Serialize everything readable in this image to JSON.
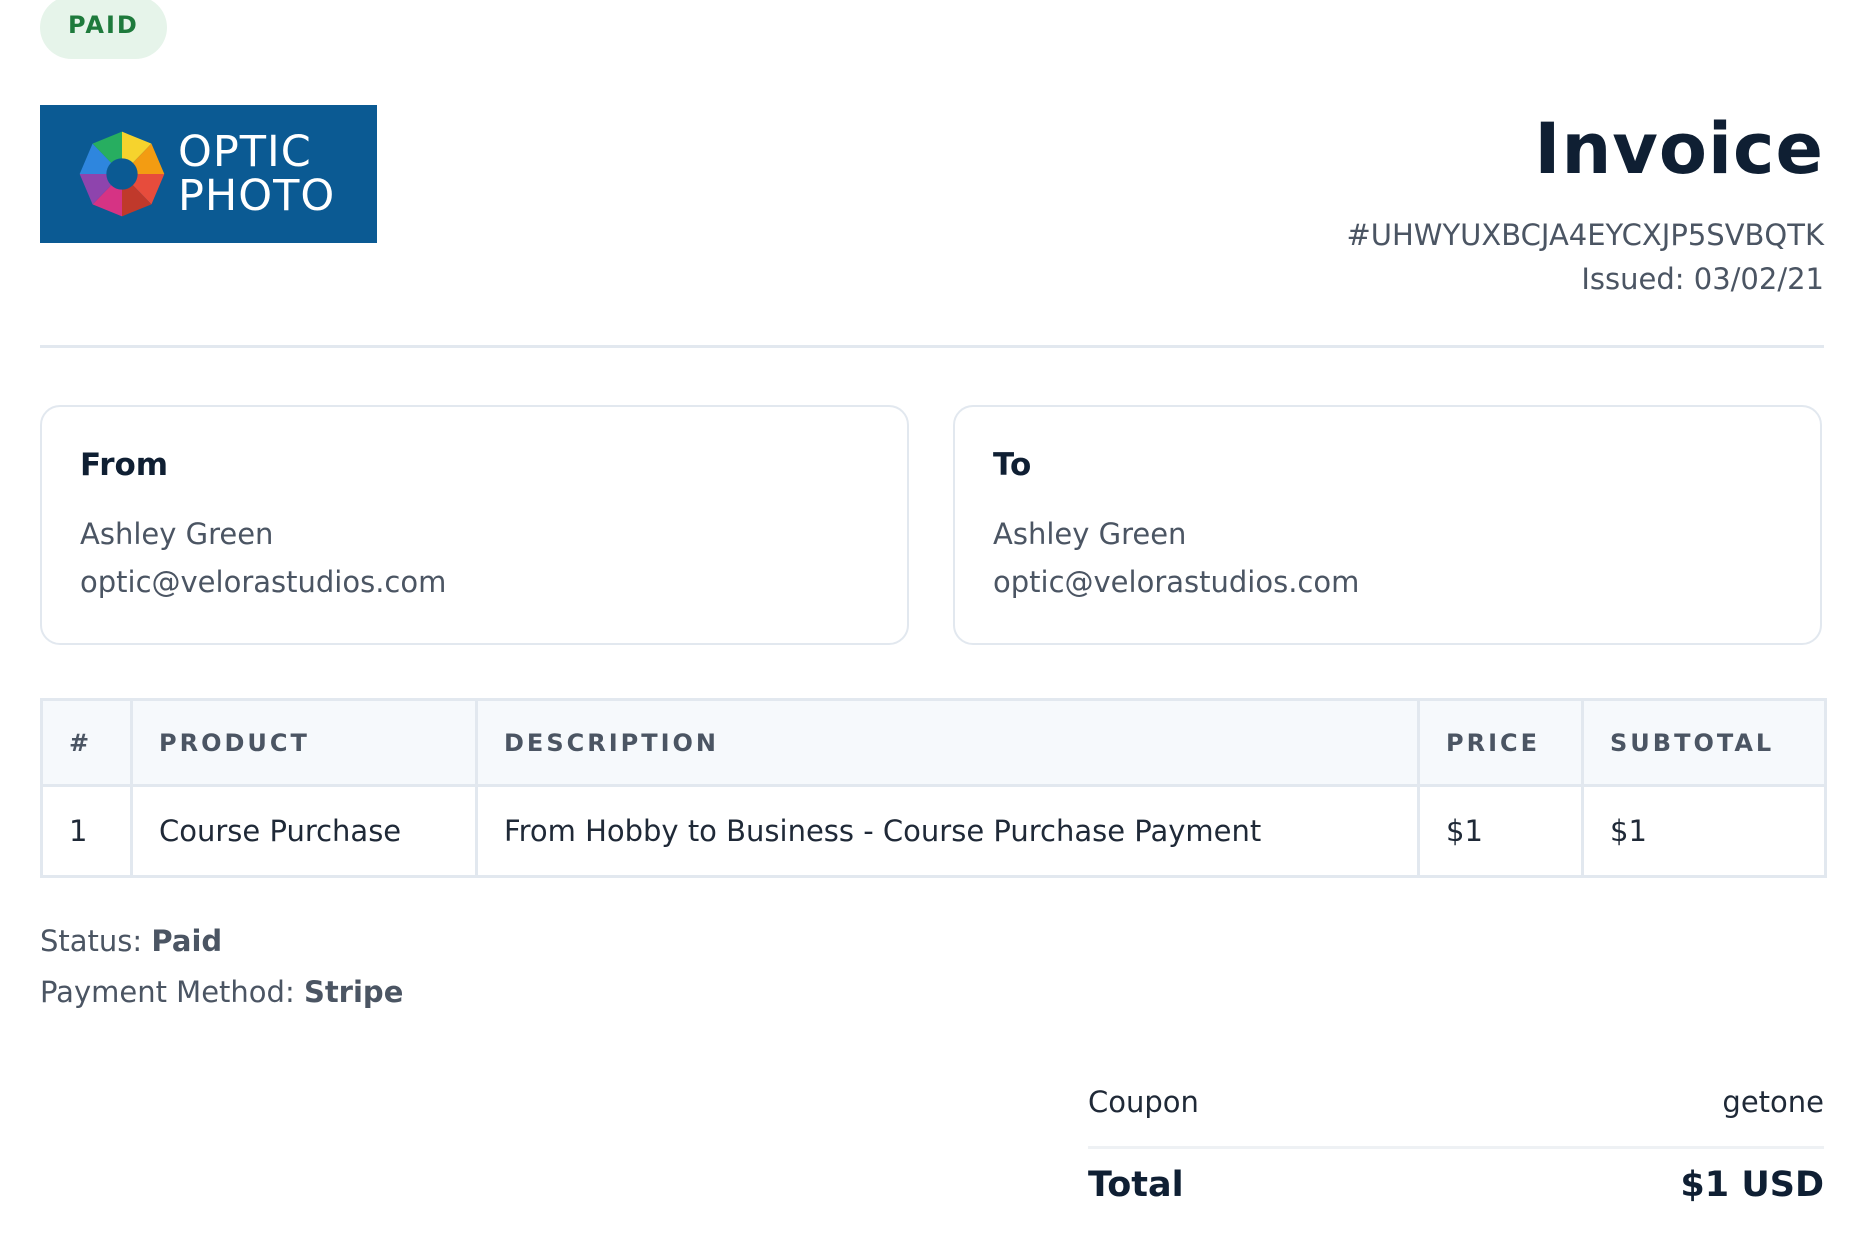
{
  "badge": {
    "label": "PAID",
    "color": "#1e7a3c",
    "background": "#e6f4ea"
  },
  "logo": {
    "line1": "OPTIC",
    "line2": "PHOTO",
    "background": "#0b5a93"
  },
  "header": {
    "title": "Invoice",
    "invoice_number": "#UHWYUXBCJA4EYCXJP5SVBQTK",
    "issued_label": "Issued:",
    "issued_date": "03/02/21"
  },
  "from": {
    "heading": "From",
    "name": "Ashley Green",
    "email": "optic@velorastudios.com"
  },
  "to": {
    "heading": "To",
    "name": "Ashley Green",
    "email": "optic@velorastudios.com"
  },
  "table": {
    "headers": [
      "#",
      "PRODUCT",
      "DESCRIPTION",
      "PRICE",
      "SUBTOTAL"
    ],
    "rows": [
      {
        "num": "1",
        "product": "Course Purchase",
        "description": "From Hobby to Business - Course Purchase Payment",
        "price": "$1",
        "subtotal": "$1"
      }
    ]
  },
  "payment": {
    "status_label": "Status:",
    "status_value": "Paid",
    "method_label": "Payment Method:",
    "method_value": "Stripe"
  },
  "summary": {
    "coupon_label": "Coupon",
    "coupon_value": "getone",
    "total_label": "Total",
    "total_value": "$1 USD"
  }
}
